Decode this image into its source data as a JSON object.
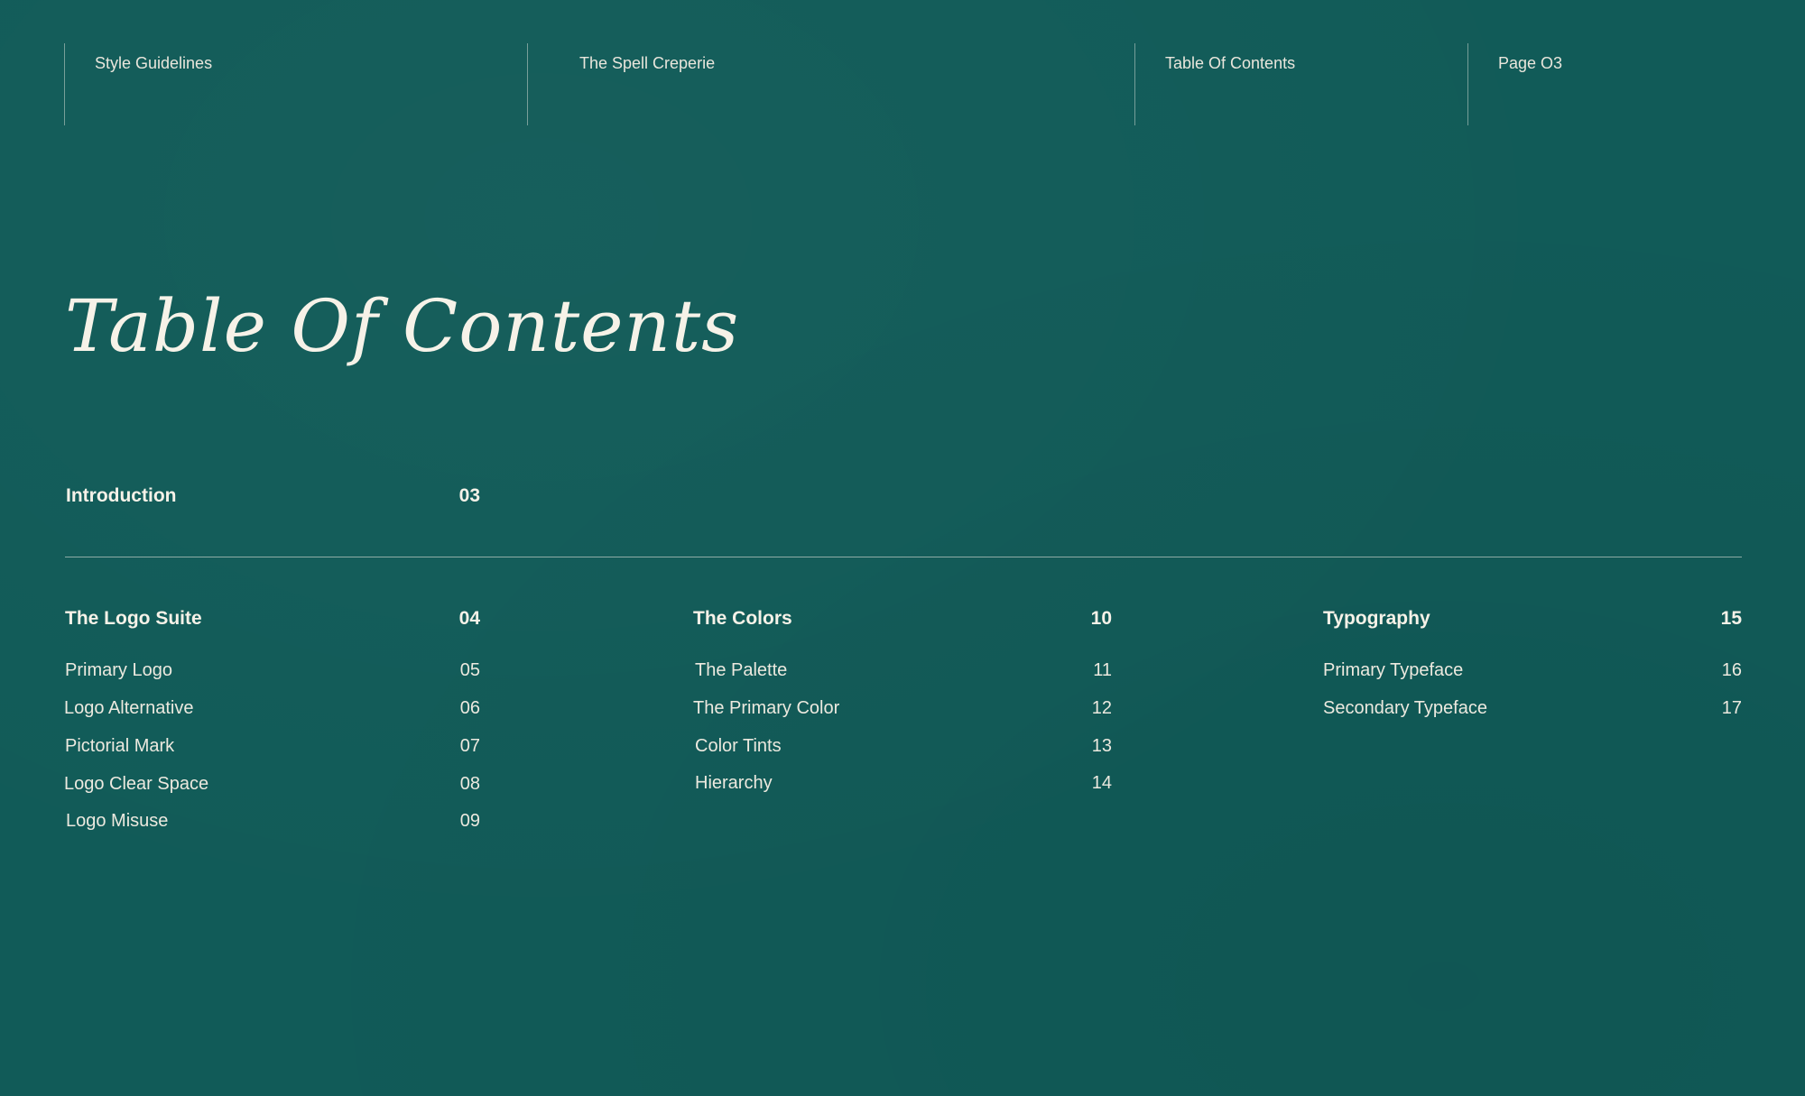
{
  "header": {
    "doc_type": "Style Guidelines",
    "brand": "The Spell Creperie",
    "section": "Table Of Contents",
    "page": "Page O3"
  },
  "title": "Table Of Contents",
  "introduction": {
    "label": "Introduction",
    "page": "03"
  },
  "columns": [
    {
      "heading": "The Logo Suite",
      "page": "04",
      "items": [
        {
          "label": "Primary Logo",
          "page": "05"
        },
        {
          "label": "Logo Alternative",
          "page": "06"
        },
        {
          "label": "Pictorial Mark",
          "page": "07"
        },
        {
          "label": "Logo Clear Space",
          "page": "08"
        },
        {
          "label": "Logo Misuse",
          "page": "09"
        }
      ]
    },
    {
      "heading": "The Colors",
      "page": "10",
      "items": [
        {
          "label": "The Palette",
          "page": "11"
        },
        {
          "label": "The Primary Color",
          "page": "12"
        },
        {
          "label": "Color Tints",
          "page": "13"
        },
        {
          "label": "Hierarchy",
          "page": "14"
        }
      ]
    },
    {
      "heading": "Typography",
      "page": "15",
      "items": [
        {
          "label": "Primary Typeface",
          "page": "16"
        },
        {
          "label": "Secondary Typeface",
          "page": "17"
        }
      ]
    }
  ],
  "colors": {
    "background": "#115b58",
    "text": "#f2efe6"
  }
}
